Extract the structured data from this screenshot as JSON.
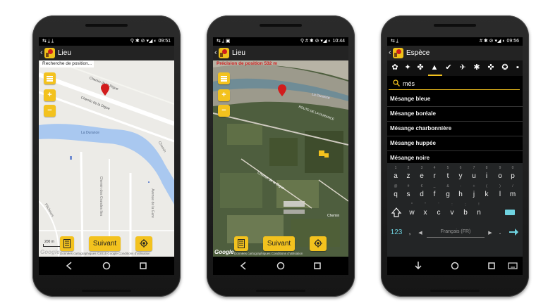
{
  "phones": [
    {
      "status": {
        "left_icons": "⇆ ⤓ ⤓",
        "right_icons": "⚲ ✱ ⊘ ▾◢ ◐",
        "time": "09:51"
      },
      "title": "Lieu",
      "map_status": "Recherche de position...",
      "map_labels": [
        "Chemin de la Digue",
        "Chemin de la Digue",
        "La Durance",
        "Chemin des Grandes Iles",
        "Avenue de la Gare",
        "Pêcheurs",
        "Chemin"
      ],
      "scale": "200 m",
      "attribution": "Données cartographiques ©2015 Google   Conditions d'utilisation",
      "google": "Google",
      "suivant_label": "Suivant",
      "map_type": "roadmap"
    },
    {
      "status": {
        "left_icons": "⇆ ⤓ ▣",
        "right_icons": "⚲ # ✱ ⊘ ▾◢ ◐",
        "time": "10:44"
      },
      "title": "Lieu",
      "map_status": "Précision de position 532 m",
      "map_labels": [
        "La Durance",
        "ROUTE DE LA DURANCE",
        "Chemin de la Digue",
        "Chemin"
      ],
      "attribution": "Données cartographiques   Conditions d'utilisation",
      "google": "Google",
      "suivant_label": "Suivant",
      "map_type": "satellite"
    },
    {
      "status": {
        "left_icons": "⇆ ⤓",
        "right_icons": "# ✱ ⊘ ▾◢ ◐",
        "time": "09:56"
      },
      "title": "Espèce",
      "search_value": "més",
      "species": [
        "Mésange bleue",
        "Mésange boréale",
        "Mésange charbonnière",
        "Mésange huppée",
        "Mésange noire"
      ],
      "keyboard": {
        "row1": [
          [
            "a",
            "1"
          ],
          [
            "z",
            "2"
          ],
          [
            "e",
            "3"
          ],
          [
            "r",
            "4"
          ],
          [
            "t",
            "5"
          ],
          [
            "y",
            "6"
          ],
          [
            "u",
            "7"
          ],
          [
            "i",
            "8"
          ],
          [
            "o",
            "9"
          ],
          [
            "p",
            "0"
          ]
        ],
        "row2": [
          [
            "q",
            "@"
          ],
          [
            "s",
            "#"
          ],
          [
            "d",
            "€"
          ],
          [
            "f",
            "_"
          ],
          [
            "g",
            "&"
          ],
          [
            "h",
            "-"
          ],
          [
            "j",
            "+"
          ],
          [
            "k",
            "("
          ],
          [
            "l",
            ")"
          ],
          [
            "m",
            "/"
          ]
        ],
        "row3": [
          [
            "w",
            "*"
          ],
          [
            "x",
            "\""
          ],
          [
            "c",
            "'"
          ],
          [
            "v",
            ":"
          ],
          [
            "b",
            ";"
          ],
          [
            "n",
            "!"
          ]
        ],
        "symbols_key": "123",
        "comma": ",",
        "space_label": "Français (FR)",
        "period": "."
      }
    }
  ],
  "colors": {
    "accent": "#f3c21e",
    "action_bar": "#232323",
    "pin": "#d21c1c",
    "keyboard_accent": "#6fd3e0"
  }
}
